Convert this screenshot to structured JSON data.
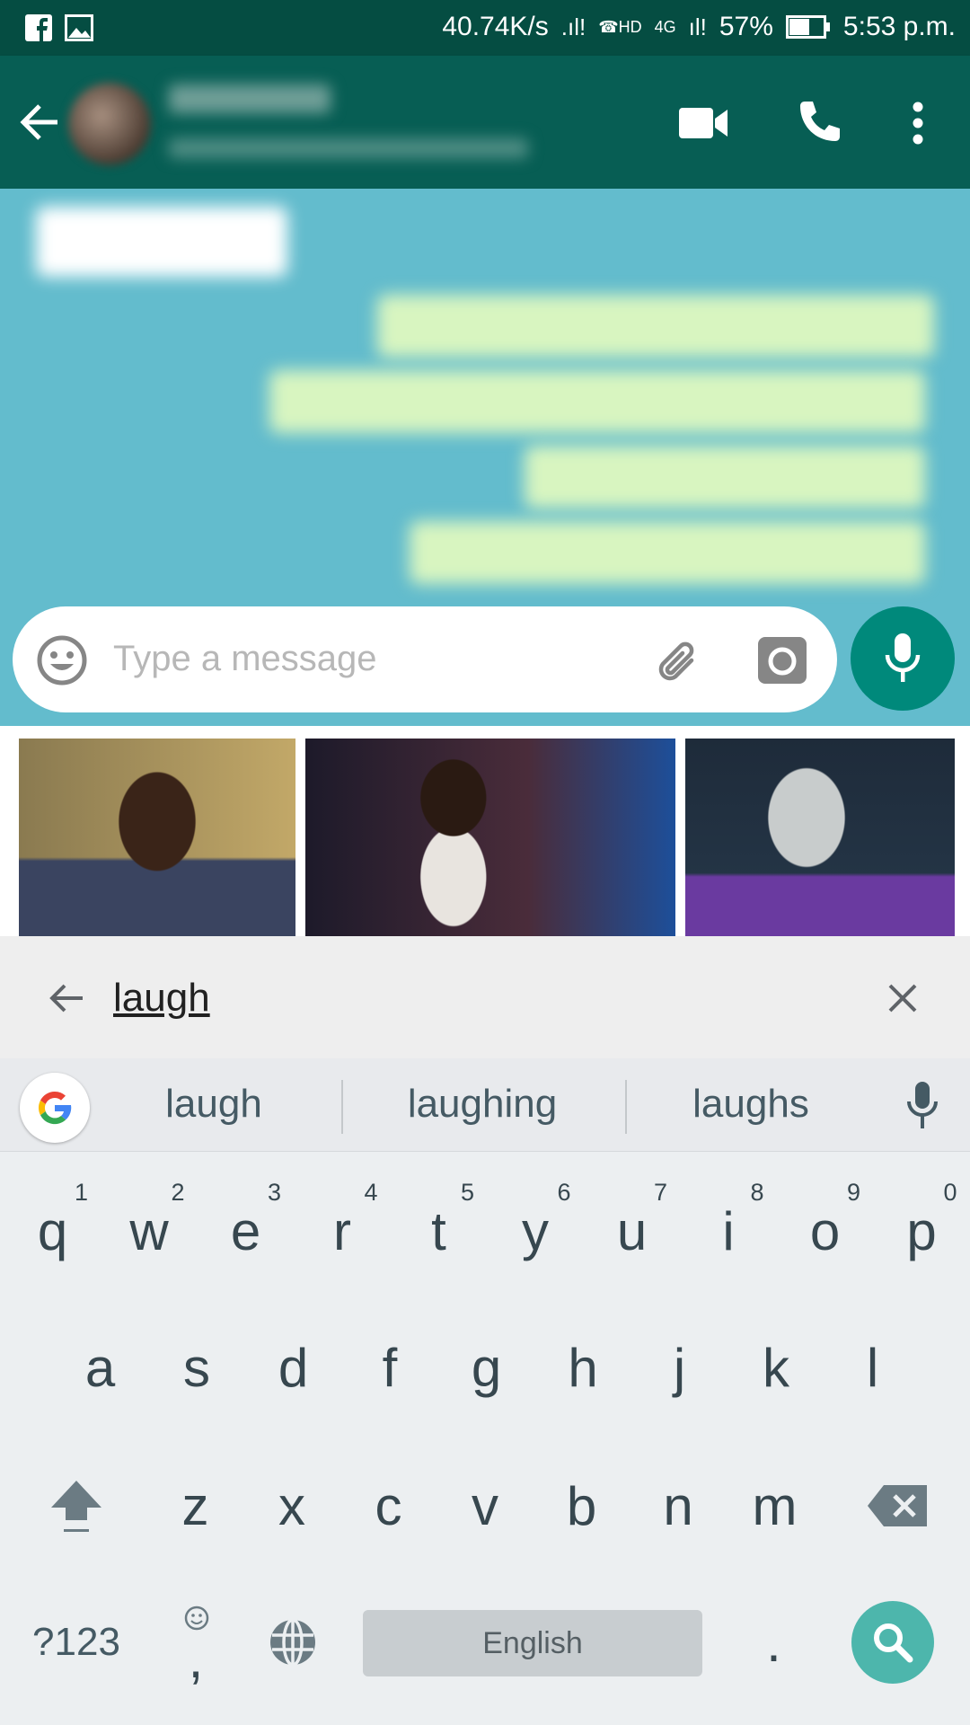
{
  "status_bar": {
    "speed": "40.74K/s",
    "network": "4G",
    "battery": "57%",
    "time": "5:53 p.m.",
    "left_icons": [
      "facebook-icon",
      "image-icon"
    ]
  },
  "header": {
    "icons": [
      "back-arrow-icon",
      "video-call-icon",
      "phone-icon",
      "more-vert-icon"
    ]
  },
  "composer": {
    "placeholder": "Type a message"
  },
  "gif_search": {
    "query": "laugh"
  },
  "suggestions": [
    "laugh",
    "laughing",
    "laughs"
  ],
  "keyboard": {
    "row1": [
      {
        "k": "q",
        "n": "1"
      },
      {
        "k": "w",
        "n": "2"
      },
      {
        "k": "e",
        "n": "3"
      },
      {
        "k": "r",
        "n": "4"
      },
      {
        "k": "t",
        "n": "5"
      },
      {
        "k": "y",
        "n": "6"
      },
      {
        "k": "u",
        "n": "7"
      },
      {
        "k": "i",
        "n": "8"
      },
      {
        "k": "o",
        "n": "9"
      },
      {
        "k": "p",
        "n": "0"
      }
    ],
    "row2": [
      "a",
      "s",
      "d",
      "f",
      "g",
      "h",
      "j",
      "k",
      "l"
    ],
    "row3": [
      "z",
      "x",
      "c",
      "v",
      "b",
      "n",
      "m"
    ],
    "symbols": "?123",
    "comma": ",",
    "space": "English",
    "period": "."
  },
  "colors": {
    "header": "#075e54",
    "accent": "#00897b",
    "search_key": "#4db6ac"
  }
}
